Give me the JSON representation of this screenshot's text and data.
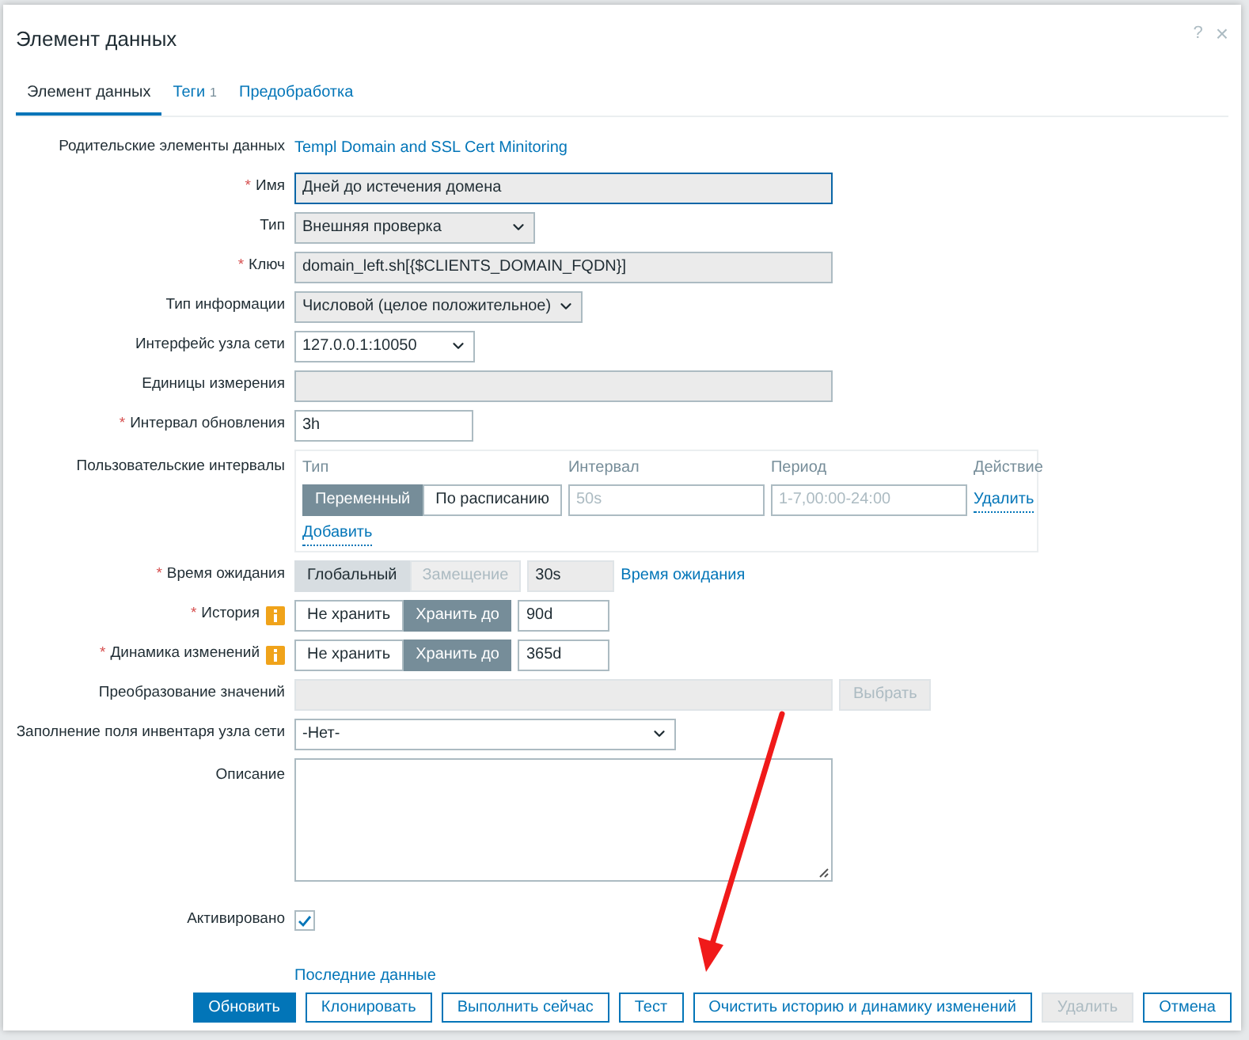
{
  "dialog": {
    "title": "Элемент данных",
    "help": "?",
    "close": "×"
  },
  "tabs": [
    {
      "label": "Элемент данных",
      "selected": true
    },
    {
      "label": "Теги",
      "count": "1",
      "selected": false
    },
    {
      "label": "Предобработка",
      "selected": false
    }
  ],
  "rows": [
    {
      "kind": "link",
      "label": "Родительские элементы данных",
      "value": "Templ Domain and SSL Cert Minitoring"
    },
    {
      "kind": "input",
      "label": "Имя",
      "required_mark": "*",
      "value": "Дней до истечения домена",
      "readonly": true,
      "focused": true
    },
    {
      "kind": "select",
      "label": "Тип",
      "value": "Внешняя проверка",
      "readonly": true
    },
    {
      "kind": "input",
      "label": "Ключ",
      "required_mark": "*",
      "value": "domain_left.sh[{$CLIENTS_DOMAIN_FQDN}]",
      "readonly": true,
      "focused": false
    },
    {
      "kind": "select",
      "label": "Тип информации",
      "value": "Числовой (целое положительное)",
      "readonly": true
    },
    {
      "kind": "select",
      "label": "Интерфейс узла сети",
      "value": "127.0.0.1:10050",
      "readonly": false
    },
    {
      "kind": "input",
      "label": "Единицы измерения",
      "readonly": true,
      "focused": false
    },
    {
      "kind": "input",
      "label": "Интервал обновления",
      "required_mark": "*",
      "value": "3h",
      "readonly": false,
      "focused": false
    },
    {
      "kind": "intervals",
      "label": "Пользовательские интервалы",
      "columns": [
        "Тип",
        "Интервал",
        "Период",
        "Действие"
      ],
      "rows": [
        {
          "options": [
            {
              "label": "Переменный",
              "selected": true
            },
            {
              "label": "По расписанию",
              "selected": false
            }
          ],
          "interval_placeholder": "50s",
          "period_placeholder": "1-7,00:00-24:00",
          "action": "Удалить"
        }
      ],
      "add": "Добавить"
    },
    {
      "kind": "timeout",
      "label": "Время ожидания",
      "required_mark": "*",
      "disabled": true,
      "options": [
        {
          "label": "Глобальный",
          "selected": true
        },
        {
          "label": "Замещение",
          "selected": false
        }
      ],
      "value": "30s",
      "link": "Время ожидания"
    },
    {
      "kind": "storage",
      "label": "История",
      "required_mark": "*",
      "options": [
        {
          "label": "Не хранить",
          "selected": false
        },
        {
          "label": "Хранить до",
          "selected": true
        }
      ],
      "value": "90d"
    },
    {
      "kind": "storage",
      "label": "Динамика изменений",
      "required_mark": "*",
      "options": [
        {
          "label": "Не хранить",
          "selected": false
        },
        {
          "label": "Хранить до",
          "selected": true
        }
      ],
      "value": "365d"
    },
    {
      "kind": "input-button",
      "label": "Преобразование значений",
      "readonly": true,
      "button": "Выбрать",
      "button_disabled": true
    },
    {
      "kind": "select",
      "label": "Заполнение поля инвентаря узла сети",
      "value": "-Нет-",
      "readonly": false
    },
    {
      "kind": "textarea",
      "label": "Описание"
    },
    {
      "kind": "checkbox",
      "label": "Активировано",
      "checked": true
    },
    {
      "kind": "plain-link",
      "value": "Последние данные"
    }
  ],
  "buttons": [
    {
      "label": "Обновить",
      "primary": true,
      "disabled": false
    },
    {
      "label": "Клонировать",
      "primary": false,
      "disabled": false
    },
    {
      "label": "Выполнить сейчас",
      "primary": false,
      "disabled": false
    },
    {
      "label": "Тест",
      "primary": false,
      "disabled": false
    },
    {
      "label": "Очистить историю и динамику изменений",
      "primary": false,
      "disabled": false
    },
    {
      "label": "Удалить",
      "primary": false,
      "disabled": true
    },
    {
      "label": "Отмена",
      "primary": false,
      "disabled": false
    }
  ]
}
